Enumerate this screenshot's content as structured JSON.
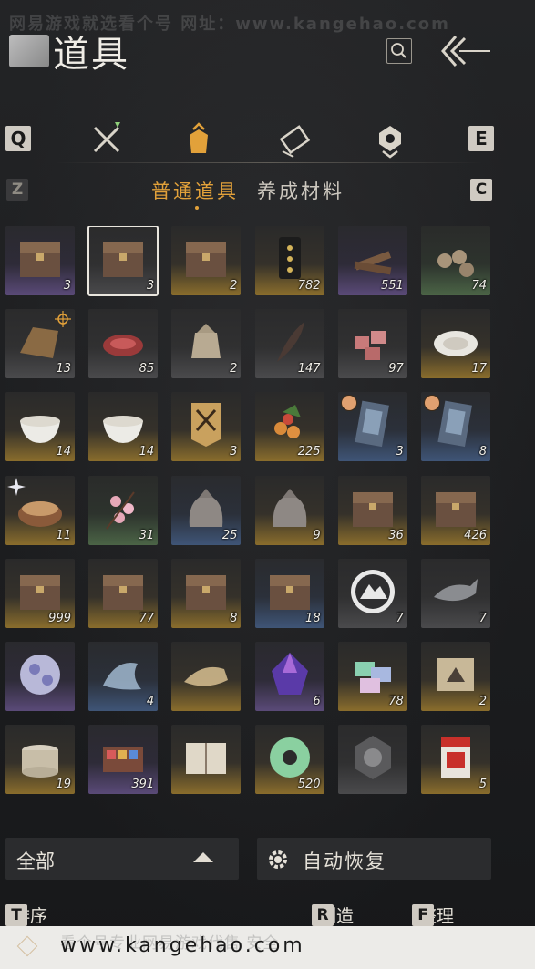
{
  "watermark": {
    "top": "网易游戏就选看个号   网址：www.kangehao.com",
    "bottom_faint": "看个号专业网易游戏代售 安全",
    "bottom_url": "www.kangehao.com"
  },
  "header": {
    "title": "道具"
  },
  "keys": {
    "q": "Q",
    "e": "E",
    "z": "Z",
    "c": "C",
    "t": "T",
    "r": "R",
    "f": "F"
  },
  "sub_tabs": [
    {
      "label": "普通道具",
      "active": true
    },
    {
      "label": "养成材料",
      "active": false
    }
  ],
  "grid_rows": [
    [
      {
        "icon": "chest-icon",
        "qty": "3",
        "rarity": "purple"
      },
      {
        "icon": "chest-icon",
        "qty": "3",
        "rarity": "grey",
        "selected": true
      },
      {
        "icon": "chest-icon",
        "qty": "2",
        "rarity": "gold"
      },
      {
        "icon": "pouch-icon",
        "qty": "782",
        "rarity": "gold"
      },
      {
        "icon": "wood-icon",
        "qty": "551",
        "rarity": "purple"
      },
      {
        "icon": "logs-icon",
        "qty": "74",
        "rarity": "green"
      }
    ],
    [
      {
        "icon": "hay-icon",
        "qty": "13",
        "rarity": "grey"
      },
      {
        "icon": "meat-icon",
        "qty": "85",
        "rarity": "grey"
      },
      {
        "icon": "grain-sack-icon",
        "qty": "2",
        "rarity": "grey"
      },
      {
        "icon": "feather-icon",
        "qty": "147",
        "rarity": "grey"
      },
      {
        "icon": "meat-cubes-icon",
        "qty": "97",
        "rarity": "grey"
      },
      {
        "icon": "plate-icon",
        "qty": "17",
        "rarity": "gold"
      }
    ],
    [
      {
        "icon": "bowl-icon",
        "qty": "14",
        "rarity": "gold"
      },
      {
        "icon": "bowl-icon",
        "qty": "14",
        "rarity": "gold"
      },
      {
        "icon": "banner-icon",
        "qty": "3",
        "rarity": "gold"
      },
      {
        "icon": "berries-icon",
        "qty": "225",
        "rarity": "gold"
      },
      {
        "icon": "ticket-icon",
        "qty": "3",
        "rarity": "blue"
      },
      {
        "icon": "ticket-icon",
        "qty": "8",
        "rarity": "blue"
      }
    ],
    [
      {
        "icon": "hotpot-icon",
        "qty": "11",
        "rarity": "gold"
      },
      {
        "icon": "blossom-icon",
        "qty": "31",
        "rarity": "green"
      },
      {
        "icon": "bag-icon",
        "qty": "25",
        "rarity": "blue"
      },
      {
        "icon": "bag-icon",
        "qty": "9",
        "rarity": "gold"
      },
      {
        "icon": "chest-icon",
        "qty": "36",
        "rarity": "gold"
      },
      {
        "icon": "chest-icon",
        "qty": "426",
        "rarity": "gold"
      }
    ],
    [
      {
        "icon": "chest-icon",
        "qty": "999",
        "rarity": "gold"
      },
      {
        "icon": "chest-icon",
        "qty": "77",
        "rarity": "gold"
      },
      {
        "icon": "chest-icon",
        "qty": "8",
        "rarity": "gold"
      },
      {
        "icon": "chest-icon",
        "qty": "18",
        "rarity": "blue"
      },
      {
        "icon": "mountain-coin-icon",
        "qty": "7",
        "rarity": "grey"
      },
      {
        "icon": "ghost-fish-icon",
        "qty": "7",
        "rarity": "grey"
      }
    ],
    [
      {
        "icon": "orb-icon",
        "qty": "",
        "rarity": "purple"
      },
      {
        "icon": "spirit-icon",
        "qty": "4",
        "rarity": "blue"
      },
      {
        "icon": "spirit-fish-icon",
        "qty": "",
        "rarity": "gold"
      },
      {
        "icon": "crystal-icon",
        "qty": "6",
        "rarity": "purple"
      },
      {
        "icon": "boxes-icon",
        "qty": "78",
        "rarity": "gold"
      },
      {
        "icon": "scroll-icon",
        "qty": "2",
        "rarity": "gold"
      }
    ],
    [
      {
        "icon": "jar-icon",
        "qty": "19",
        "rarity": "gold"
      },
      {
        "icon": "tray-icon",
        "qty": "391",
        "rarity": "purple"
      },
      {
        "icon": "book-icon",
        "qty": "",
        "rarity": "gold"
      },
      {
        "icon": "jade-ring-icon",
        "qty": "520",
        "rarity": "gold"
      },
      {
        "icon": "medal-icon",
        "qty": "",
        "rarity": "grey"
      },
      {
        "icon": "red-envelope-icon",
        "qty": "5",
        "rarity": "gold"
      }
    ]
  ],
  "bottom": {
    "filter_label": "全部",
    "auto_label": "自动恢复"
  },
  "actions": [
    {
      "key": "T",
      "label": "排序"
    },
    {
      "key": "R",
      "label": "制造"
    },
    {
      "key": "F",
      "label": "整理"
    }
  ],
  "colors": {
    "accent": "#e2a13a",
    "text": "#e5e1d8"
  }
}
